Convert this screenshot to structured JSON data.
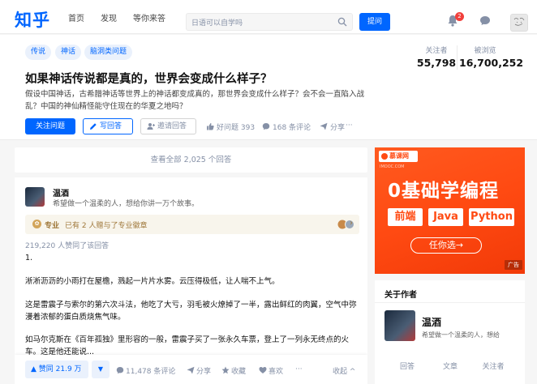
{
  "nav": {
    "logo": "知乎",
    "links": [
      "首页",
      "发现",
      "等你来答"
    ],
    "search_placeholder": "日语可以自学吗",
    "ask_label": "提问",
    "notification_count": "2"
  },
  "question": {
    "tags": [
      "传说",
      "神话",
      "脑洞类问题"
    ],
    "title": "如果神话传说都是真的，世界会变成什么样子？",
    "detail": "假设中国神话，古希腊神话等世界上的神话都变成真的，那世界会变成什么样子？会不会一直陷入战乱？中国的神仙精怪能守住现在的华夏之地吗？",
    "followers_label": "关注者",
    "followers": "55,798",
    "views_label": "被浏览",
    "views": "16,700,252",
    "follow_label": "关注问题",
    "write_label": "写回答",
    "invite_label": "邀请回答",
    "good_q": "好问题 393",
    "comments": "168 条评论",
    "share": "分享",
    "more": "···"
  },
  "main": {
    "view_all": "查看全部 2,025 个回答",
    "answer": {
      "author": "温酒",
      "bio": "希望做一个温柔的人，想给你讲一万个故事。",
      "pro_label": "专业",
      "pro_text": "已有 2 人赠与了专业徽章",
      "agree_count": "219,220 人赞同了该回答",
      "paragraphs": [
        "1.",
        "淅淅沥沥的小雨打在屋檐，溅起一片片水雾。云压得极低，让人喘不上气。",
        "这是雷震子与索尔的第六次斗法，他吃了大亏，羽毛被火燎掉了一半，露出鲜红的肉翼，空气中弥漫着浓郁的蛋白质烧焦气味。",
        "如马尔克斯在《百年孤独》里形容的一般，雷震子买了一张永久车票，登上了一列永无终点的火车。这是他还能说..."
      ],
      "vote_label": "▲ 赞同 21.9 万",
      "down_label": "▼",
      "comments": "11,478 条评论",
      "share": "分享",
      "collect": "收藏",
      "like": "喜欢",
      "more": "···",
      "collapse": "收起 ^"
    }
  },
  "sidebar": {
    "ad": {
      "brand": "慕课网",
      "sub": "IMOOC.COM",
      "title": "0基础学编程",
      "chips": [
        "前端",
        "Java",
        "Python"
      ],
      "cta": "任你选→",
      "tag": "广告"
    },
    "author": {
      "section_title": "关于作者",
      "name": "温酒",
      "bio": "希望做一个温柔的人，想给",
      "stats": [
        "回答",
        "文章",
        "关注者"
      ]
    }
  },
  "colors": {
    "brand": "#0066ff",
    "ad": "#ff4a12",
    "pro": "#a0793c"
  }
}
